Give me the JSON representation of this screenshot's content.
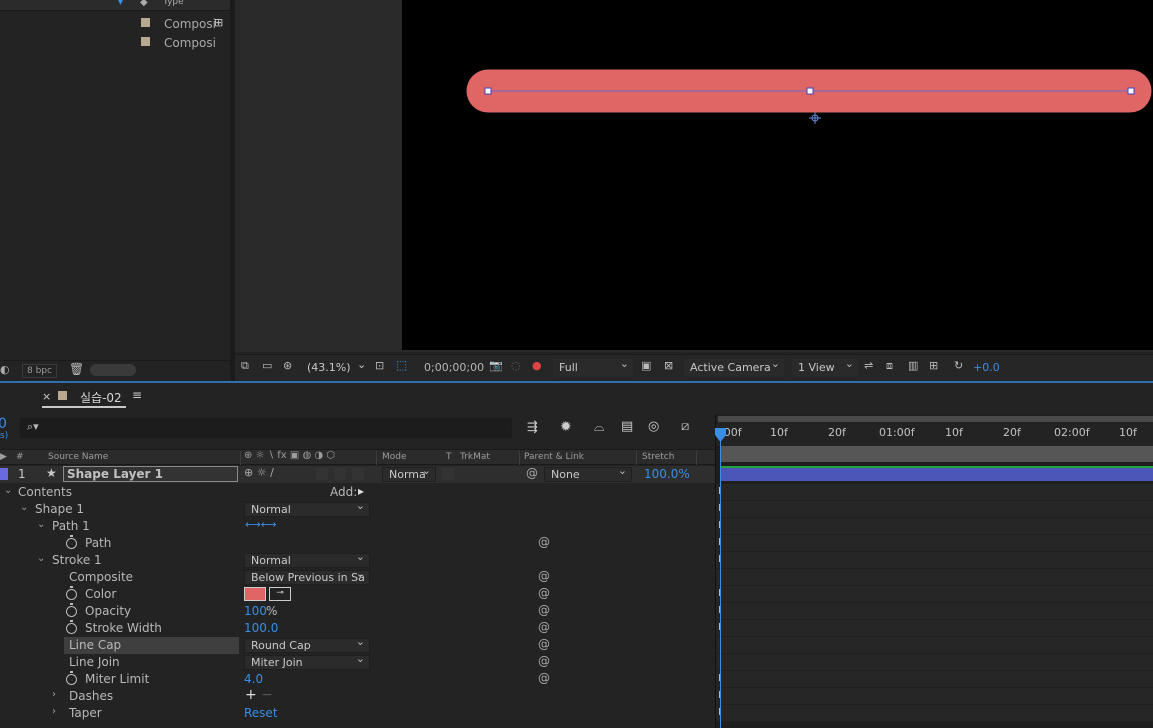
{
  "project": {
    "col_type": "Type",
    "items": [
      {
        "name": "Composi"
      },
      {
        "name": "Composi"
      }
    ],
    "bpc": "8 bpc"
  },
  "viewer": {
    "zoom": "(43.1%)",
    "timecode": "0;00;00;00",
    "resolution": "Full",
    "camera": "Active Camera",
    "views": "1 View",
    "exposure": "+0.0",
    "shape_color": "#e06666"
  },
  "timeline": {
    "tab_name": "실습-02",
    "columns": {
      "num": "#",
      "source": "Source Name",
      "mode": "Mode",
      "t": "T",
      "trkmat": "TrkMat",
      "parent": "Parent & Link",
      "stretch": "Stretch"
    },
    "layer": {
      "number": "1",
      "name": "Shape Layer 1",
      "mode": "Norma",
      "parent": "None",
      "stretch": "100.0%"
    },
    "add_label": "Add:",
    "props": {
      "contents": "Contents",
      "shape1": "Shape 1",
      "shape1_mode": "Normal",
      "path1": "Path 1",
      "path": "Path",
      "stroke1": "Stroke 1",
      "stroke1_mode": "Normal",
      "composite": "Composite",
      "composite_val": "Below Previous in Sa",
      "color": "Color",
      "opacity": "Opacity",
      "opacity_val": "100",
      "opacity_unit": "%",
      "stroke_width": "Stroke Width",
      "stroke_width_val": "100.0",
      "line_cap": "Line Cap",
      "line_cap_val": "Round Cap",
      "line_join": "Line Join",
      "line_join_val": "Miter Join",
      "miter_limit": "Miter Limit",
      "miter_limit_val": "4.0",
      "dashes": "Dashes",
      "taper": "Taper",
      "taper_val": "Reset"
    },
    "ruler_ticks": [
      ":00f",
      "10f",
      "20f",
      "01:00f",
      "10f",
      "20f",
      "02:00f",
      "10f"
    ]
  }
}
